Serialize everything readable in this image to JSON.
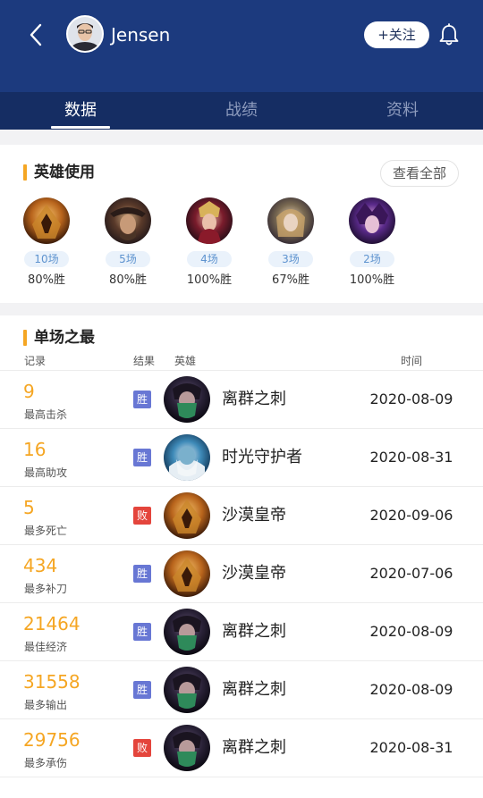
{
  "header": {
    "player_name": "Jensen",
    "follow_label": "+关注"
  },
  "tabs": [
    {
      "label": "数据",
      "active": true
    },
    {
      "label": "战绩",
      "active": false
    },
    {
      "label": "资料",
      "active": false
    }
  ],
  "hero_usage": {
    "title": "英雄使用",
    "view_all_label": "查看全部",
    "heroes": [
      {
        "games": "10场",
        "winrate": "80%胜",
        "avatar": "azir"
      },
      {
        "games": "5场",
        "winrate": "80%胜",
        "avatar": "twisted-fate"
      },
      {
        "games": "4场",
        "winrate": "100%胜",
        "avatar": "leblanc"
      },
      {
        "games": "3场",
        "winrate": "67%胜",
        "avatar": "orianna"
      },
      {
        "games": "2场",
        "winrate": "100%胜",
        "avatar": "syndra"
      }
    ]
  },
  "single_best": {
    "title": "单场之最",
    "columns": {
      "record": "记录",
      "result": "结果",
      "hero": "英雄",
      "time": "时间"
    },
    "rows": [
      {
        "value": "9",
        "label": "最高击杀",
        "result": "胜",
        "outcome": "win",
        "hero": "离群之刺",
        "avatar": "akali",
        "time": "2020-08-09"
      },
      {
        "value": "16",
        "label": "最高助攻",
        "result": "胜",
        "outcome": "win",
        "hero": "时光守护者",
        "avatar": "zilean",
        "time": "2020-08-31"
      },
      {
        "value": "5",
        "label": "最多死亡",
        "result": "败",
        "outcome": "loss",
        "hero": "沙漠皇帝",
        "avatar": "azir",
        "time": "2020-09-06"
      },
      {
        "value": "434",
        "label": "最多补刀",
        "result": "胜",
        "outcome": "win",
        "hero": "沙漠皇帝",
        "avatar": "azir",
        "time": "2020-07-06"
      },
      {
        "value": "21464",
        "label": "最佳经济",
        "result": "胜",
        "outcome": "win",
        "hero": "离群之刺",
        "avatar": "akali",
        "time": "2020-08-09"
      },
      {
        "value": "31558",
        "label": "最多输出",
        "result": "胜",
        "outcome": "win",
        "hero": "离群之刺",
        "avatar": "akali",
        "time": "2020-08-09"
      },
      {
        "value": "29756",
        "label": "最多承伤",
        "result": "败",
        "outcome": "loss",
        "hero": "离群之刺",
        "avatar": "akali",
        "time": "2020-08-31"
      }
    ]
  },
  "colors": {
    "header_bg": "#1c3a7e",
    "tab_bg": "#152d63",
    "accent": "#f5a623",
    "win": "#6877d4",
    "loss": "#e4453c"
  }
}
